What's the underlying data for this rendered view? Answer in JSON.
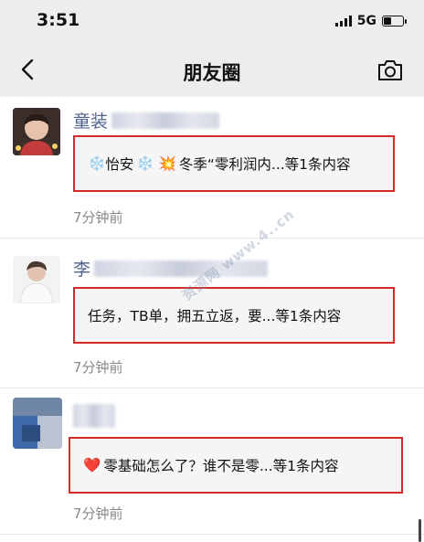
{
  "status_bar": {
    "time": "3:51",
    "network": "5G",
    "signal_icon": "signal-bars-icon",
    "battery_icon": "battery-icon"
  },
  "nav": {
    "title": "朋友圈",
    "back_icon": "back-arrow-icon",
    "camera_icon": "camera-icon"
  },
  "posts": [
    {
      "name": "童装",
      "content_emoji_left": "❄️",
      "content": "怡安",
      "content_emoji_mid": "❄️ 💥",
      "content_tail": "冬季“零利润内...等1条内容",
      "time": "7分钟前"
    },
    {
      "name": "李",
      "content": "任务，TB单，拥五立返，要...等1条内容",
      "time": "7分钟前"
    },
    {
      "name": "",
      "content_emoji_left": "❤️",
      "content": "零基础怎么了？谁不是零...等1条内容",
      "time": "7分钟前"
    }
  ],
  "watermark": "资源网 www.4..cn",
  "colors": {
    "name": "#51638f",
    "highlight_border": "#d42a2a",
    "timestamp": "#888888"
  }
}
